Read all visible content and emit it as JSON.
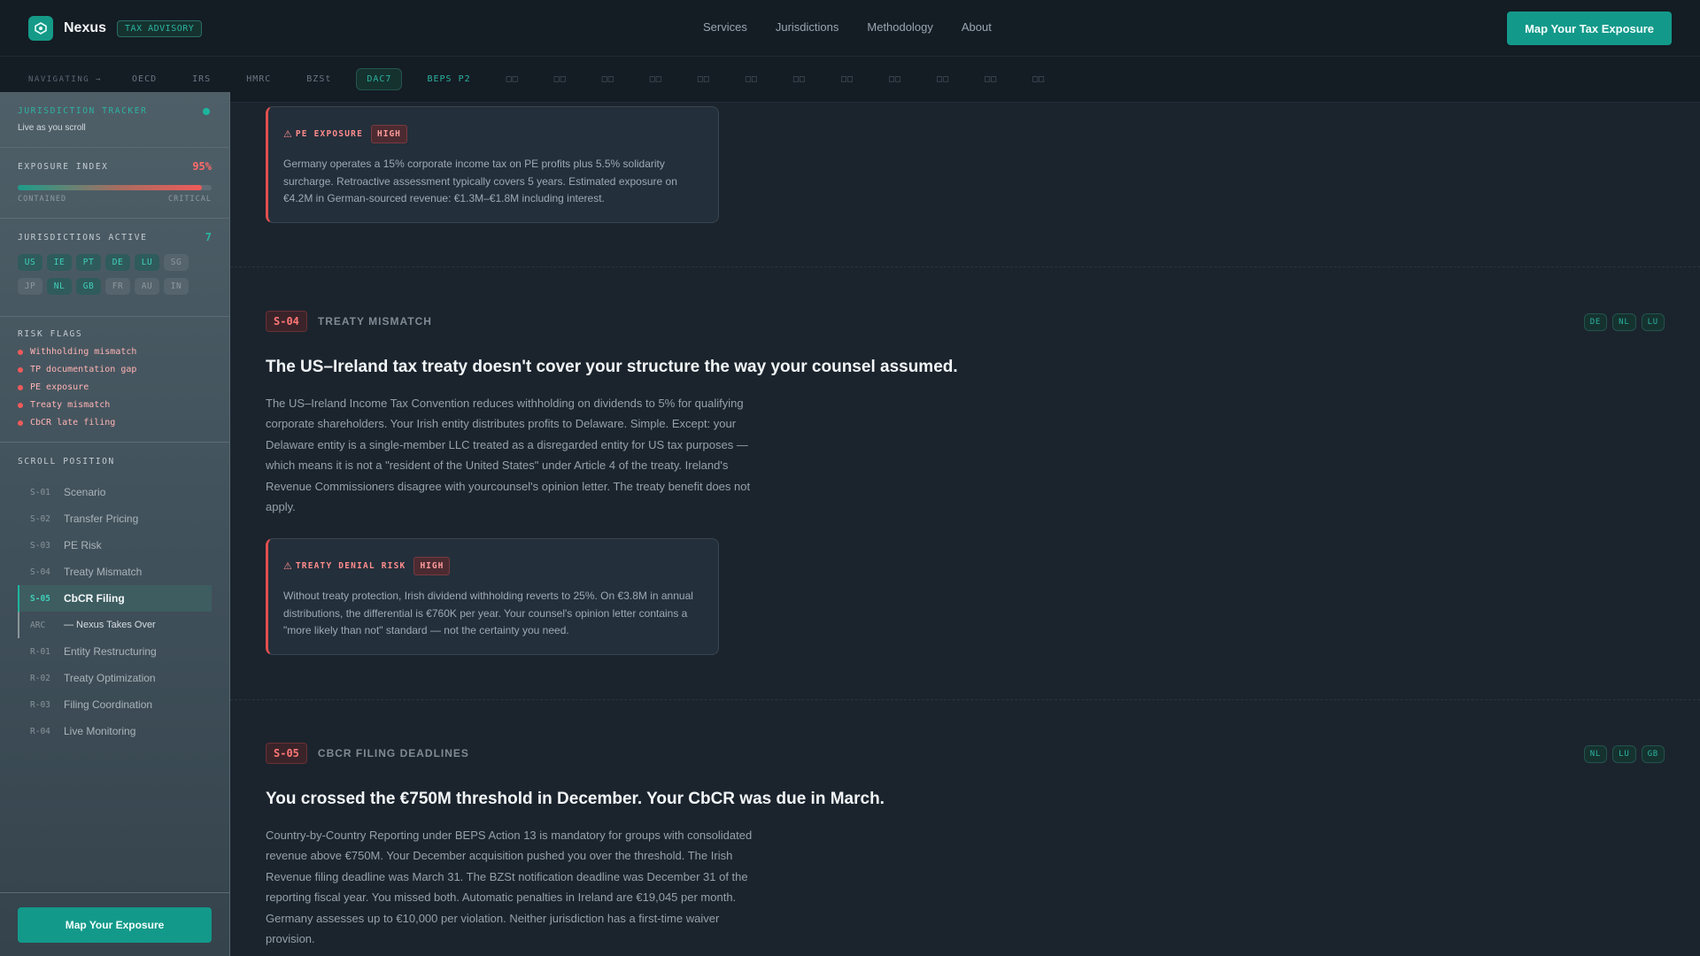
{
  "nav": {
    "brand": "Nexus",
    "badge": "TAX ADVISORY",
    "links": [
      "Services",
      "Jurisdictions",
      "Methodology",
      "About"
    ],
    "cta": "Map Your Tax Exposure"
  },
  "subnav": {
    "label": "NAVIGATING →",
    "chips": [
      "OECD",
      "IRS",
      "HMRC",
      "BZSt",
      "DAC7",
      "BEPS P2"
    ],
    "active": "DAC7",
    "placeholders": [
      "□□",
      "□□",
      "□□",
      "□□",
      "□□",
      "□□",
      "□□",
      "□□",
      "□□",
      "□□",
      "□□",
      "□□"
    ]
  },
  "sidebar": {
    "tracker_title": "JURISDICTION TRACKER",
    "tracker_sub": "Live as you scroll",
    "exposure_title": "EXPOSURE INDEX",
    "exposure_value": "95%",
    "exposure_fraction": 0.95,
    "exposure_low": "CONTAINED",
    "exposure_high": "CRITICAL",
    "jurisdictions_title": "JURISDICTIONS ACTIVE",
    "jurisdictions_count": "7",
    "jurisdictions": [
      {
        "code": "US",
        "active": true
      },
      {
        "code": "IE",
        "active": true
      },
      {
        "code": "PT",
        "active": true
      },
      {
        "code": "DE",
        "active": true
      },
      {
        "code": "LU",
        "active": true
      },
      {
        "code": "SG",
        "active": false
      },
      {
        "code": "JP",
        "active": false
      },
      {
        "code": "NL",
        "active": true
      },
      {
        "code": "GB",
        "active": true
      },
      {
        "code": "FR",
        "active": false
      },
      {
        "code": "AU",
        "active": false
      },
      {
        "code": "IN",
        "active": false
      }
    ],
    "risk_title": "RISK FLAGS",
    "risk_flags": [
      "Withholding mismatch",
      "TP documentation gap",
      "PE exposure",
      "Treaty mismatch",
      "CbCR late filing"
    ],
    "scroll_title": "SCROLL POSITION",
    "scroll_items": [
      {
        "code": "S-01",
        "label": "Scenario",
        "state": ""
      },
      {
        "code": "S-02",
        "label": "Transfer Pricing",
        "state": ""
      },
      {
        "code": "S-03",
        "label": "PE Risk",
        "state": ""
      },
      {
        "code": "S-04",
        "label": "Treaty Mismatch",
        "state": ""
      },
      {
        "code": "S-05",
        "label": "CbCR Filing",
        "state": "active"
      },
      {
        "code": "ARC",
        "label": "— Nexus Takes Over",
        "state": "arc"
      },
      {
        "code": "R-01",
        "label": "Entity Restructuring",
        "state": ""
      },
      {
        "code": "R-02",
        "label": "Treaty Optimization",
        "state": ""
      },
      {
        "code": "R-03",
        "label": "Filing Coordination",
        "state": ""
      },
      {
        "code": "R-04",
        "label": "Live Monitoring",
        "state": ""
      }
    ],
    "cta": "Map Your Exposure"
  },
  "main": {
    "pe_alert": {
      "title": "PE EXPOSURE",
      "severity": "HIGH",
      "body": "Germany operates a 15% corporate income tax on PE profits plus 5.5% solidarity surcharge. Retroactive assessment typically covers 5 years. Estimated exposure on €4.2M in German-sourced revenue: €1.3M–€1.8M including interest."
    },
    "s04": {
      "code": "S-04",
      "label": "TREATY MISMATCH",
      "tags": [
        "DE",
        "NL",
        "LU"
      ],
      "headline": "The US–Ireland tax treaty doesn't cover your structure the way your counsel assumed.",
      "body": "The US–Ireland Income Tax Convention reduces withholding on dividends to 5% for qualifying corporate shareholders. Your Irish entity distributes profits to Delaware. Simple. Except: your Delaware entity is a single-member LLC treated as a disregarded entity for US tax purposes — which means it is not a \"resident of the United States\" under Article 4 of the treaty. Ireland's Revenue Commissioners disagree with yourcounsel's opinion letter. The treaty benefit does not apply.",
      "alert": {
        "title": "TREATY DENIAL RISK",
        "severity": "HIGH",
        "body": "Without treaty protection, Irish dividend withholding reverts to 25%. On €3.8M in annual distributions, the differential is €760K per year. Your counsel's opinion letter contains a \"more likely than not\" standard — not the certainty you need."
      }
    },
    "s05": {
      "code": "S-05",
      "label": "CBCR FILING DEADLINES",
      "tags": [
        "NL",
        "LU",
        "GB"
      ],
      "headline": "You crossed the €750M threshold in December. Your CbCR was due in March.",
      "body": "Country-by-Country Reporting under BEPS Action 13 is mandatory for groups with consolidated revenue above €750M. Your December acquisition pushed you over the threshold. The Irish Revenue filing deadline was March 31. The BZSt notification deadline was December 31 of the reporting fiscal year. You missed both. Automatic penalties in Ireland are €19,045 per month. Germany assesses up to €10,000 per violation. Neither jurisdiction has a first-time waiver provision."
    }
  }
}
